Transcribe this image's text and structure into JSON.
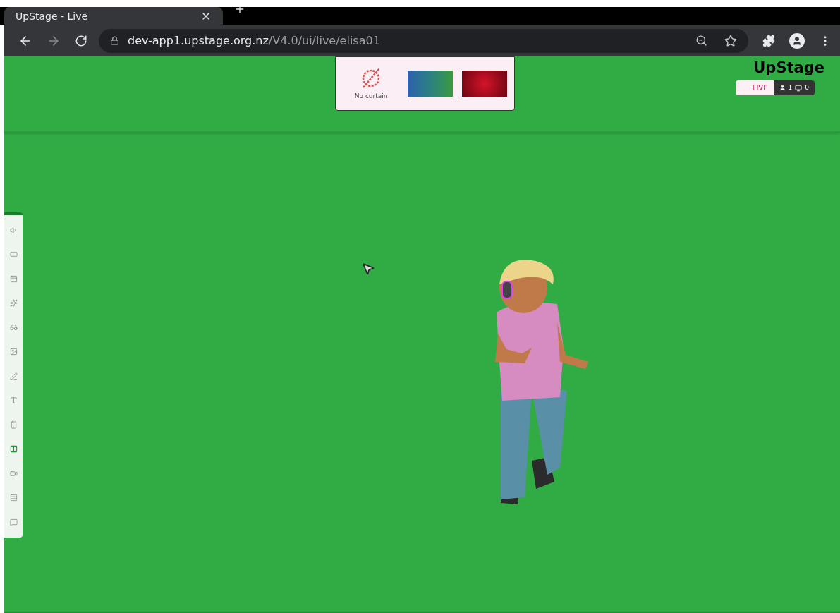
{
  "browser": {
    "tab_title": "UpStage - Live",
    "url_host": "dev-app1.upstage.org.nz",
    "url_path": "/V4.0/ui/live/elisa01"
  },
  "curtains": [
    {
      "kind": "none",
      "label": "No curtain"
    },
    {
      "kind": "gradient"
    },
    {
      "kind": "red"
    }
  ],
  "logo": "UpStage",
  "status": {
    "live": "LIVE",
    "players": "1",
    "viewers": "0"
  },
  "tools": [
    {
      "kind": "audio",
      "selected": false
    },
    {
      "kind": "backdrop",
      "selected": false
    },
    {
      "kind": "curtain",
      "selected": false
    },
    {
      "kind": "props",
      "selected": false
    },
    {
      "kind": "avatars",
      "selected": false
    },
    {
      "kind": "media",
      "selected": false
    },
    {
      "kind": "draw",
      "selected": false
    },
    {
      "kind": "text",
      "selected": false
    },
    {
      "kind": "stream",
      "selected": false
    },
    {
      "kind": "scenes",
      "selected": true
    },
    {
      "kind": "meeting",
      "selected": false
    },
    {
      "kind": "settings",
      "selected": false
    },
    {
      "kind": "chat",
      "selected": false
    }
  ]
}
